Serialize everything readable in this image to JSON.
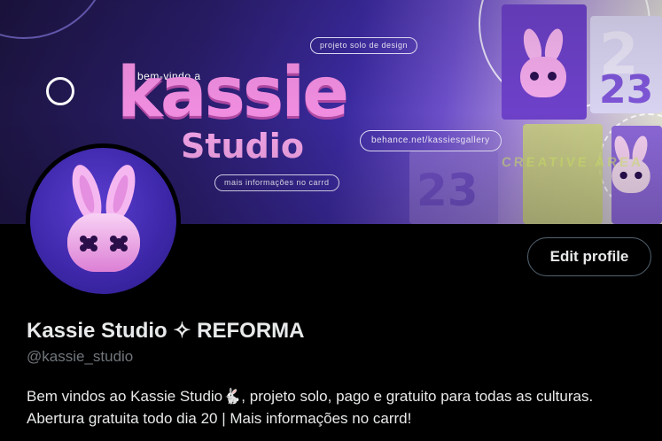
{
  "banner": {
    "welcome": "bem-vindo a",
    "logo_main": "kassie",
    "logo_sub": "Studio",
    "pill_design": "projeto solo de design",
    "pill_behance": "behance.net/kassiesgallery",
    "pill_carrd": "mais informações no carrd",
    "creative_area": "CREATIVE AREA",
    "colors": {
      "deep": "#1c1440",
      "violet": "#3b2aa0",
      "pink": "#f08de0",
      "cream": "#e8ecd0"
    }
  },
  "profile": {
    "display_name": "Kassie Studio ✧ REFORMA",
    "handle": "@kassie_studio",
    "bio": "Bem vindos ao Kassie Studio🐇, projeto solo, pago e gratuito para todas as culturas. Abertura gratuita todo dia 20 | Mais informações no carrd!",
    "edit_button": "Edit profile",
    "avatar_icon": "bunny-mascot-icon"
  }
}
